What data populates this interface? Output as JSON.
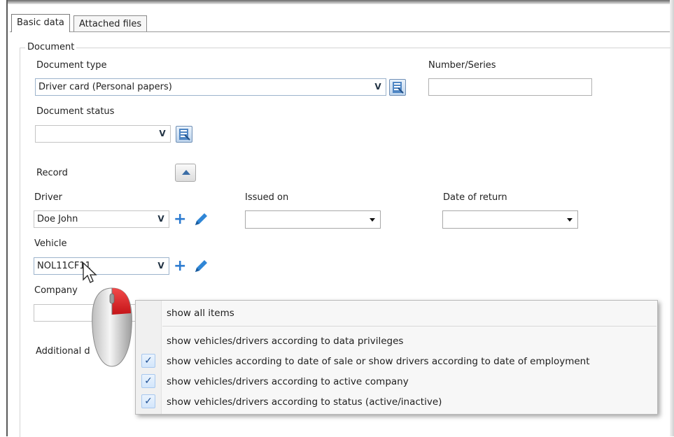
{
  "tabs": [
    {
      "label": "Basic data",
      "active": true
    },
    {
      "label": "Attached files",
      "active": false
    }
  ],
  "document_group": {
    "title": "Document",
    "document_type": {
      "label": "Document type",
      "value": "Driver card (Personal papers)",
      "dropdown_glyph": "V"
    },
    "number_series": {
      "label": "Number/Series",
      "value": ""
    },
    "document_status": {
      "label": "Document status",
      "value": "",
      "dropdown_glyph": "V"
    },
    "record": {
      "label": "Record"
    },
    "driver": {
      "label": "Driver",
      "value": "Doe John",
      "dropdown_glyph": "V"
    },
    "issued_on": {
      "label": "Issued on",
      "value": ""
    },
    "date_of_return": {
      "label": "Date of return",
      "value": ""
    },
    "vehicle": {
      "label": "Vehicle",
      "value": "NOL11CF11",
      "dropdown_glyph": "V"
    },
    "company": {
      "label": "Company",
      "value": ""
    },
    "additional": {
      "label": "Additional d"
    }
  },
  "icons": {
    "book": "book-list-icon",
    "add": "plus-icon",
    "edit": "pencil-icon",
    "collapse": "triangle-up-icon",
    "mouse": "mouse-right-click-icon"
  },
  "context_menu": {
    "items": [
      {
        "label": "show all items",
        "checked": false
      },
      {
        "label": "show vehicles/drivers according to data privileges",
        "checked": false
      },
      {
        "label": "show vehicles according to date of sale or show drivers according to date of employment",
        "checked": true
      },
      {
        "label": "show vehicles/drivers according to active company",
        "checked": true
      },
      {
        "label": "show vehicles/drivers according to status (active/inactive)",
        "checked": true
      }
    ],
    "check_glyph": "✓"
  },
  "colors": {
    "accent_blue": "#2c7bd0",
    "mouse_button_red": "#e0262b"
  }
}
